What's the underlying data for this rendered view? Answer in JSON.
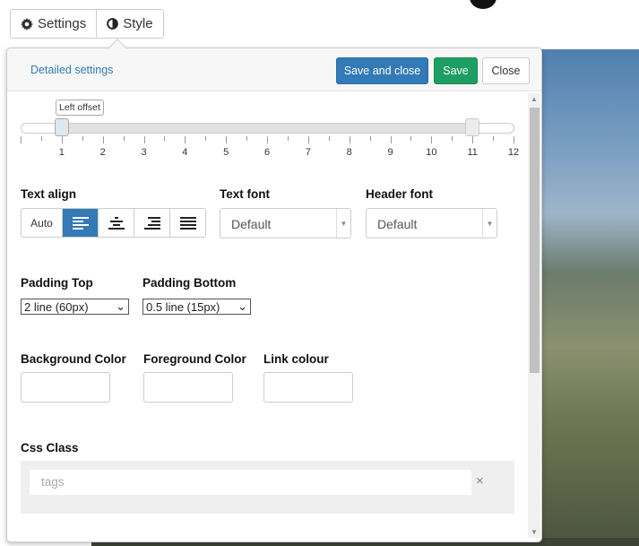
{
  "tabs": [
    {
      "label": "Settings",
      "icon": "gear-icon"
    },
    {
      "label": "Style",
      "icon": "contrast-icon"
    }
  ],
  "header": {
    "detailed_settings": "Detailed settings",
    "save_and_close": "Save and close",
    "save": "Save",
    "close": "Close"
  },
  "slider": {
    "tooltip": "Left offset",
    "min": 0,
    "max": 12,
    "from": 1,
    "to": 11,
    "labels": [
      "1",
      "2",
      "3",
      "4",
      "5",
      "6",
      "7",
      "8",
      "9",
      "10",
      "11",
      "12"
    ]
  },
  "text_align": {
    "label": "Text align",
    "auto": "Auto",
    "selected": "left",
    "options": [
      "auto",
      "left",
      "center",
      "right",
      "justify"
    ]
  },
  "text_font": {
    "label": "Text font",
    "value": "Default"
  },
  "header_font": {
    "label": "Header font",
    "value": "Default"
  },
  "padding_top": {
    "label": "Padding Top",
    "value": "2 line (60px)"
  },
  "padding_bottom": {
    "label": "Padding Bottom",
    "value": "0.5 line (15px)"
  },
  "colors": {
    "background": {
      "label": "Background Color",
      "value": ""
    },
    "foreground": {
      "label": "Foreground Color",
      "value": ""
    },
    "link": {
      "label": "Link colour",
      "value": ""
    }
  },
  "css_class": {
    "label": "Css Class",
    "placeholder": "tags",
    "clear": "×"
  },
  "accent": {
    "primary": "#337ab7",
    "success": "#1e9e62"
  }
}
